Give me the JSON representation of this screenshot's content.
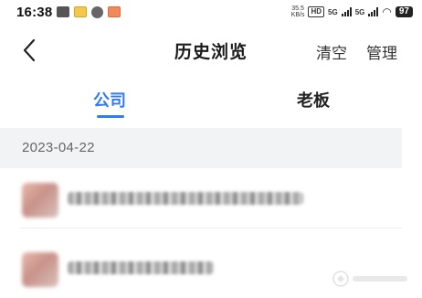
{
  "status_bar": {
    "time": "16:38",
    "network_speed_value": "35.5",
    "network_speed_unit": "KB/s",
    "hd_label": "HD",
    "signal1_label": "5G",
    "signal2_label": "5G",
    "battery_level": "97",
    "icons": [
      "mail-icon",
      "notification-app-icon",
      "compass-app-icon",
      "notification-app-icon-2",
      "wifi-icon"
    ]
  },
  "header": {
    "back_icon": "chevron-left-icon",
    "title": "历史浏览",
    "clear_label": "清空",
    "manage_label": "管理"
  },
  "tabs": [
    {
      "label": "公司",
      "active": true
    },
    {
      "label": "老板",
      "active": false
    }
  ],
  "colors": {
    "accent": "#2f7cf6",
    "section_bg": "#f2f3f5"
  },
  "history": {
    "groups": [
      {
        "date": "2023-04-22",
        "items": [
          {
            "name_redacted": true
          },
          {
            "name_redacted": true
          }
        ]
      }
    ]
  }
}
